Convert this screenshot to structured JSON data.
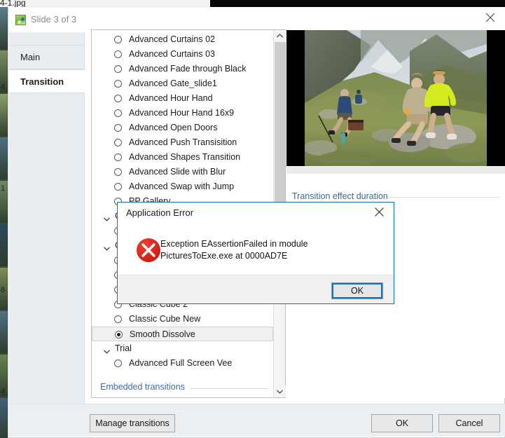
{
  "background_app": {
    "title_fragment": "4-1.jpg",
    "slide_numbers": [
      "4",
      "1",
      "8",
      "4"
    ]
  },
  "window": {
    "title": "Slide 3 of 3",
    "icon": "slide-image-icon",
    "close_icon": "close-icon"
  },
  "tabs": [
    {
      "label": "Main",
      "active": false
    },
    {
      "label": "Transition",
      "active": true
    }
  ],
  "slide_nav": {
    "prev_icon": "prev-arrow-icon",
    "next_icon": "next-arrow-icon"
  },
  "transitions_list": {
    "embedded_link": "Embedded transitions",
    "selected": "Smooth Dissolve",
    "scroll": {
      "up_icon": "chevron-up-icon",
      "down_icon": "chevron-down-icon"
    },
    "rows": [
      {
        "type": "radio",
        "label": "Advanced Curtains 02",
        "selected": false
      },
      {
        "type": "radio",
        "label": "Advanced Curtains 03",
        "selected": false
      },
      {
        "type": "radio",
        "label": "Advanced Fade through Black",
        "selected": false
      },
      {
        "type": "radio",
        "label": "Advanced Gate_slide1",
        "selected": false
      },
      {
        "type": "radio",
        "label": "Advanced Hour Hand",
        "selected": false
      },
      {
        "type": "radio",
        "label": "Advanced Hour Hand 16x9",
        "selected": false
      },
      {
        "type": "radio",
        "label": "Advanced Open Doors",
        "selected": false
      },
      {
        "type": "radio",
        "label": "Advanced Push Transisition",
        "selected": false
      },
      {
        "type": "radio",
        "label": "Advanced Shapes Transition",
        "selected": false
      },
      {
        "type": "radio",
        "label": "Advanced Slide with Blur",
        "selected": false
      },
      {
        "type": "radio",
        "label": "Advanced Swap with Jump",
        "selected": false
      },
      {
        "type": "radio",
        "label": "PP Gallery",
        "selected": false
      },
      {
        "type": "group",
        "label": "Cu",
        "selected": false
      },
      {
        "type": "radio",
        "label": "",
        "selected": false
      },
      {
        "type": "group",
        "label": "Cu",
        "selected": false
      },
      {
        "type": "radio",
        "label": "",
        "selected": false
      },
      {
        "type": "radio",
        "label": "",
        "selected": false
      },
      {
        "type": "radio",
        "label": "",
        "selected": false
      },
      {
        "type": "radio",
        "label": "Classic Cube 2",
        "selected": false
      },
      {
        "type": "radio",
        "label": "Classic Cube New",
        "selected": false
      },
      {
        "type": "radio",
        "label": "Smooth Dissolve",
        "selected": true
      },
      {
        "type": "group",
        "label": "Trial",
        "selected": false
      },
      {
        "type": "radio",
        "label": "Advanced Full Screen Vee",
        "selected": false
      }
    ]
  },
  "preview": {
    "photo_alt": "hikers-resting-alpine-valley-photo"
  },
  "duration_section": {
    "label": "Transition effect duration"
  },
  "footer": {
    "manage_label": "Manage transitions",
    "ok_label": "OK",
    "cancel_label": "Cancel"
  },
  "error_dialog": {
    "title": "Application Error",
    "message": "Exception EAssertionFailed  in module PicturesToExe.exe at 0000AD7E",
    "ok_label": "OK",
    "close_icon": "close-icon",
    "error_icon": "error-cross-icon",
    "accent_color": "#0a74c8",
    "icon_color": "#d01c12"
  }
}
